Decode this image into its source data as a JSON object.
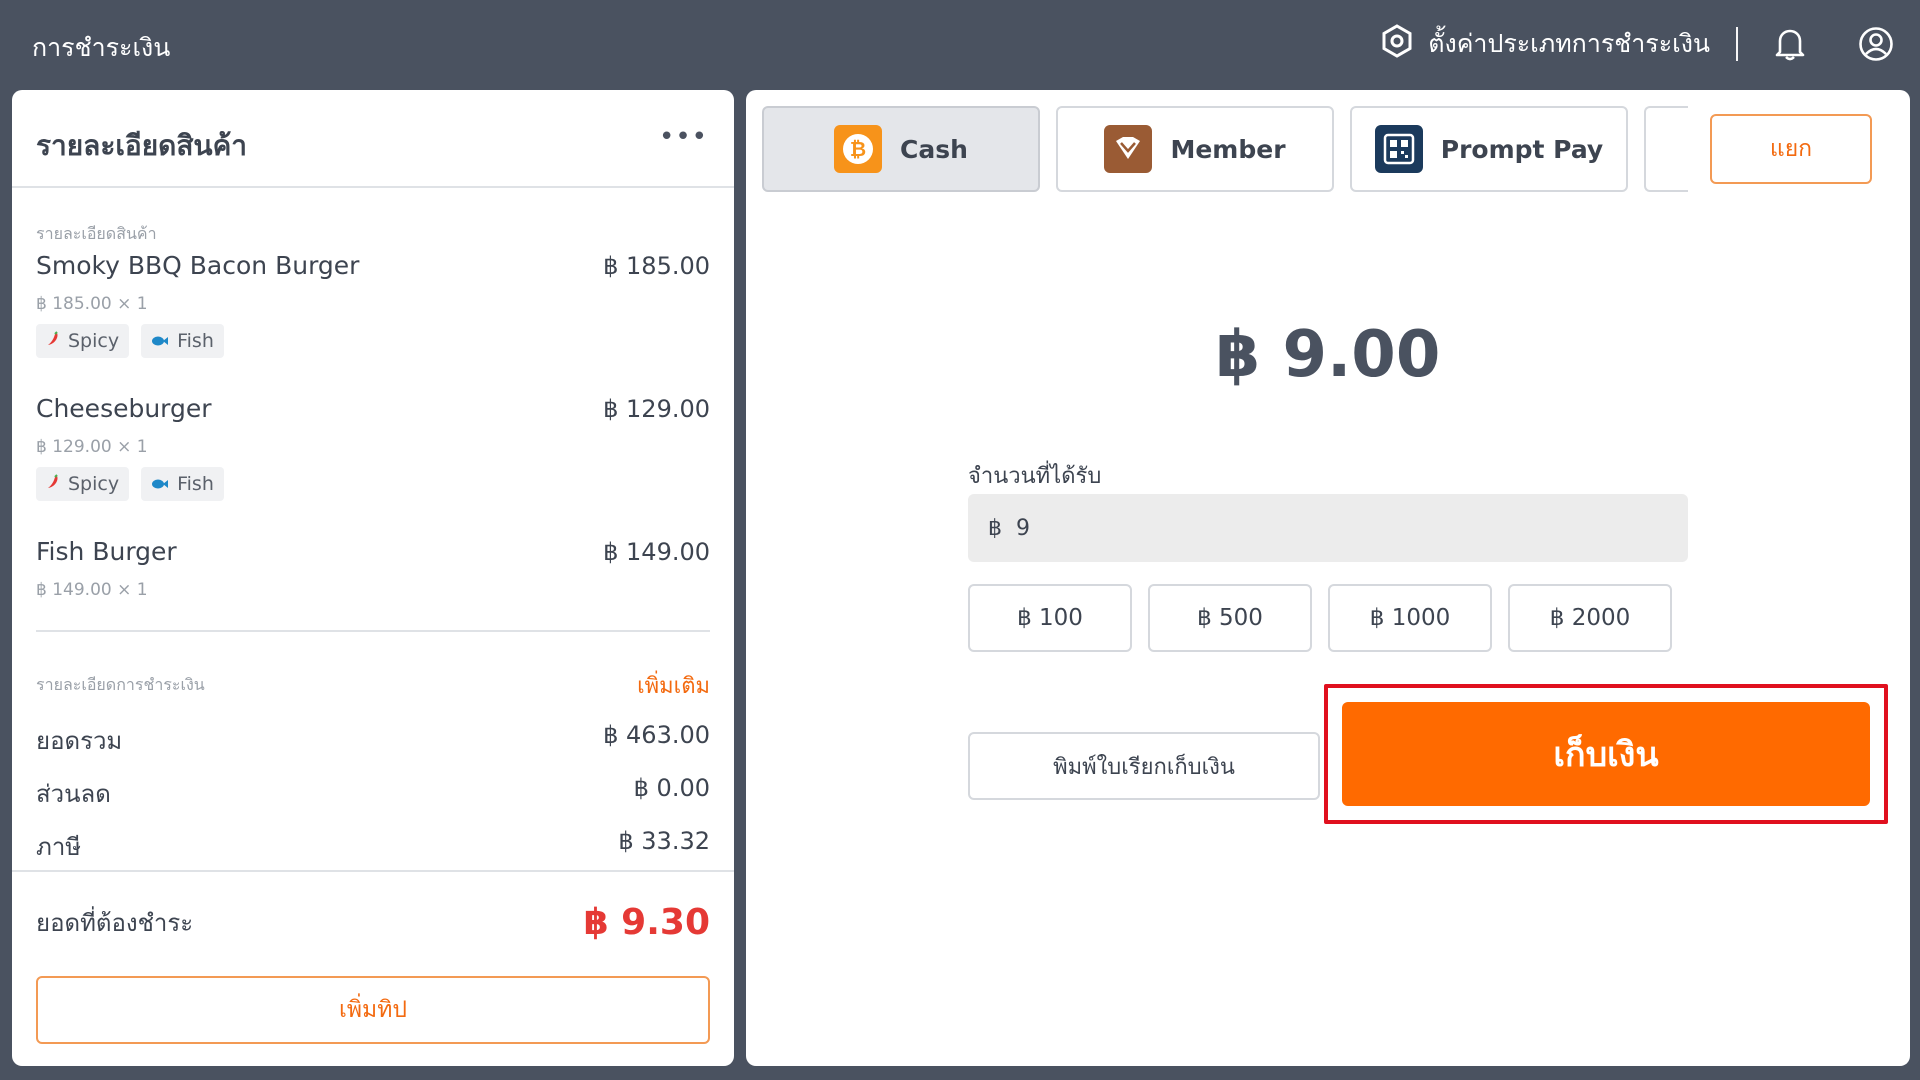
{
  "header": {
    "title": "การชำระเงิน",
    "settings_label": "ตั้งค่าประเภทการชำระเงิน"
  },
  "order": {
    "title": "รายละเอียดสินค้า",
    "more": "•••",
    "items_label": "รายละเอียดสินค้า",
    "items": [
      {
        "name": "Smoky BBQ Bacon Burger",
        "price": "฿ 185.00",
        "detail": "฿ 185.00 × 1",
        "tags": [
          "Spicy",
          "Fish"
        ]
      },
      {
        "name": "Cheeseburger",
        "price": "฿ 129.00",
        "detail": "฿ 129.00 × 1",
        "tags": [
          "Spicy",
          "Fish"
        ]
      },
      {
        "name": "Fish Burger",
        "price": "฿ 149.00",
        "detail": "฿ 149.00 × 1",
        "tags": []
      }
    ]
  },
  "payment_details": {
    "label": "รายละเอียดการชำระเงิน",
    "add_label": "เพิ่มเติม",
    "subtotal_label": "ยอดรวม",
    "subtotal": "฿ 463.00",
    "discount_label": "ส่วนลด",
    "discount": "฿ 0.00",
    "tax_label": "ภาษี",
    "tax": "฿ 33.32",
    "due_label": "ยอดที่ต้องชำระ",
    "due": "฿ 9.30",
    "tip_button": "เพิ่มทิป"
  },
  "methods": {
    "tabs": [
      {
        "label": "Cash",
        "icon": "bitcoin-icon",
        "active": true
      },
      {
        "label": "Member",
        "icon": "diamond-icon",
        "active": false
      },
      {
        "label": "Prompt Pay",
        "icon": "qr-code-icon",
        "active": false
      }
    ],
    "split_button": "แยก"
  },
  "cash": {
    "amount": "฿ 9.00",
    "received_label": "จำนวนที่ได้รับ",
    "currency": "฿",
    "received_value": "9",
    "quick_amounts": [
      "฿ 100",
      "฿ 500",
      "฿ 1000",
      "฿ 2000"
    ],
    "print_button": "พิมพ์ใบเรียกเก็บเงิน",
    "collect_button": "เก็บเงิน"
  },
  "colors": {
    "accent": "#ff6a00",
    "due": "#e53935",
    "topbar": "#4a5260",
    "highlight": "#e0101e"
  }
}
